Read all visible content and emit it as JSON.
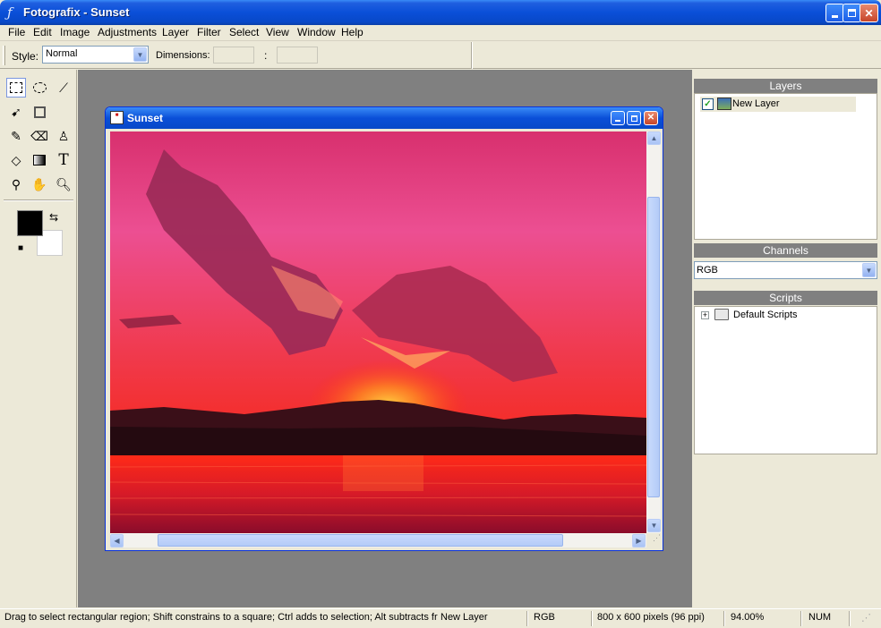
{
  "window": {
    "title": "Fotografix - Sunset",
    "app_icon": "feather-icon"
  },
  "menu": [
    "File",
    "Edit",
    "Image",
    "Adjustments",
    "Layer",
    "Filter",
    "Select",
    "View",
    "Window",
    "Help"
  ],
  "toolbar": {
    "style_label": "Style:",
    "style_value": "Normal",
    "dimensions_label": "Dimensions:",
    "dimensions_separator": ":",
    "dim_width": "",
    "dim_height": ""
  },
  "tools": [
    "rect-select",
    "ellipse-select",
    "magic-wand",
    "move",
    "crop",
    "brush",
    "eraser",
    "clone-stamp",
    "paint-bucket",
    "gradient",
    "text",
    "eyedropper",
    "hand",
    "zoom"
  ],
  "colors": {
    "foreground": "#000000",
    "background": "#ffffff"
  },
  "document": {
    "title": "Sunset",
    "icon": "document-icon"
  },
  "panels": {
    "layers": {
      "title": "Layers",
      "items": [
        {
          "name": "New Layer",
          "visible": true
        }
      ]
    },
    "channels": {
      "title": "Channels",
      "value": "RGB"
    },
    "scripts": {
      "title": "Scripts",
      "items": [
        {
          "name": "Default Scripts",
          "expand": "+"
        }
      ]
    }
  },
  "status": {
    "hint": "Drag to select rectangular region; Shift constrains to a square; Ctrl adds to selection; Alt subtracts fr",
    "layer": "New Layer",
    "mode": "RGB",
    "size": "800 x 600 pixels (96 ppi)",
    "zoom": "94.00%",
    "num": "NUM"
  }
}
